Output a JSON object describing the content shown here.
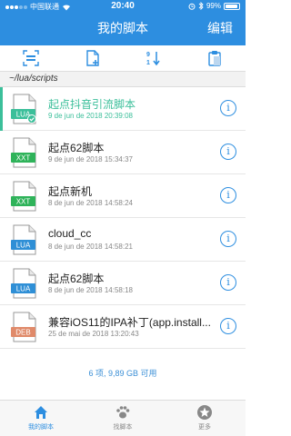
{
  "status_bar": {
    "carrier": "中国联通",
    "time": "20:40",
    "battery": "99%"
  },
  "header": {
    "title": "我的脚本",
    "edit_label": "编辑"
  },
  "path": "~/lua/scripts",
  "files": [
    {
      "name": "起点抖音引流脚本",
      "date": "9 de jun de 2018 20:39:08",
      "type": "LUA",
      "color": "#3bbf9a",
      "active": true
    },
    {
      "name": "起点62脚本",
      "date": "9 de jun de 2018 15:34:37",
      "type": "XXT",
      "color": "#2fb35a",
      "active": false
    },
    {
      "name": "起点新机",
      "date": "8 de jun de 2018 14:58:24",
      "type": "XXT",
      "color": "#2fb35a",
      "active": false
    },
    {
      "name": "cloud_cc",
      "date": "8 de jun de 2018 14:58:21",
      "type": "LUA",
      "color": "#2f8fd6",
      "active": false
    },
    {
      "name": "起点62脚本",
      "date": "8 de jun de 2018 14:58:18",
      "type": "LUA",
      "color": "#2f8fd6",
      "active": false
    },
    {
      "name": "兼容iOS11的IPA补丁(app.install...",
      "date": "25 de mai de 2018 13:20:43",
      "type": "DEB",
      "color": "#e08a6a",
      "active": false
    }
  ],
  "summary": "6 项, 9,89 GB 可用",
  "tabs": [
    {
      "label": "我的脚本",
      "active": true
    },
    {
      "label": "找脚本",
      "active": false
    },
    {
      "label": "更多",
      "active": false
    }
  ],
  "colors": {
    "accent": "#2d8ee0",
    "active_row": "#3bbf9a"
  }
}
